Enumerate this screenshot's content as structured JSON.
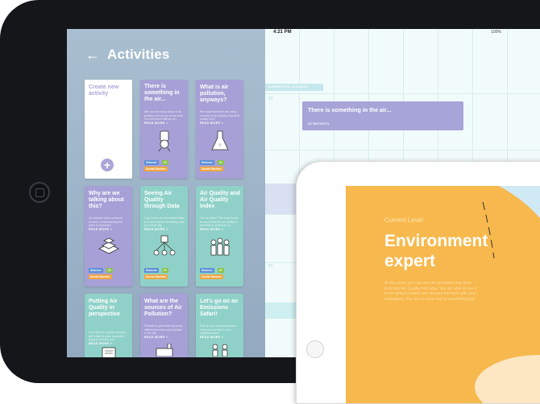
{
  "ipad_main": {
    "status": {
      "time": "4:21 PM",
      "battery": "100%"
    },
    "activities_panel": {
      "back_icon": "←",
      "title": "Activities",
      "create_card": {
        "label": "Create new activity",
        "plus_icon": "+"
      },
      "cards": [
        {
          "title": "There is something in the air...",
          "desc": "We can see many kinds of air pollution but do you know what it is and how it affects us?",
          "read_more": "READ MORE »",
          "tags": [
            "Science",
            "4+"
          ],
          "tag2": "Social Studies",
          "icon": "air-sampler-illustration"
        },
        {
          "title": "What is air pollution, anyways?",
          "desc": "We know that there are many sources of air pollution but what exactly is it?",
          "read_more": "READ MORE »",
          "tags": [
            "Science",
            "4+"
          ],
          "tag2": "Social Studies",
          "icon": "flask-illustration"
        },
        {
          "title": "Why are we talking about this?",
          "desc": "Air pollution does not know borders. Understanding the issue is important.",
          "read_more": "READ MORE »",
          "tags": [
            "Science",
            "4+"
          ],
          "tag2": "Social Studies",
          "icon": "city-blocks-illustration"
        },
        {
          "title": "Seeing Air Quality through Data",
          "desc": "Log in to an environmental data tool and explore monitoring data for a local city.",
          "read_more": "READ MORE »",
          "tags": [
            "Science",
            "4+"
          ],
          "tag2": "Social Studies",
          "icon": "data-tree-illustration"
        },
        {
          "title": "Air Quality and Air Quality Index",
          "desc": "The air index? The index helps us know what the air quality is and what it means for us.",
          "read_more": "READ MORE »",
          "tags": [
            "Science",
            "4+"
          ],
          "tag2": "Social Studies",
          "icon": "crowd-illustration"
        },
        {
          "title": "Putting Air Quality in perspective",
          "desc": "How does air quality compare with cities in other countries? Explore and find out.",
          "read_more": "READ MORE »",
          "tags": [],
          "tag2": "",
          "icon": "document-illustration"
        },
        {
          "title": "What are the sources of Air Pollution?",
          "desc": "Pollution is generated by many different sources and activities in the city.",
          "read_more": "READ MORE »",
          "tags": [],
          "tag2": "",
          "icon": "factory-illustration"
        },
        {
          "title": "Let's go on an Emissions Safari!",
          "desc": "Pick up your camera and see what you can find in your neighbourhood.",
          "read_more": "READ MORE »",
          "tags": [],
          "tag2": "",
          "icon": "people-illustration"
        }
      ]
    },
    "calendar": {
      "tier_label": "CONNECTED CLASSES",
      "event_title": "There is something in the air...",
      "event_sub": "28 REPORTS",
      "day_numbers": [
        "21",
        "21",
        "22"
      ]
    }
  },
  "ipad_second": {
    "level_label": "Current Level",
    "level_name": "Environment expert",
    "level_desc": "At this point, you can see the problems that arise from bad Air Quality from afar. You are able to see it in the global context and discuss the topic with your colleagues. You are on your way to something big!"
  },
  "colors": {
    "panel": "#9fb5c9",
    "purple": "#a6a0d6",
    "teal": "#8fd1c8",
    "orange": "#f7b84d"
  }
}
